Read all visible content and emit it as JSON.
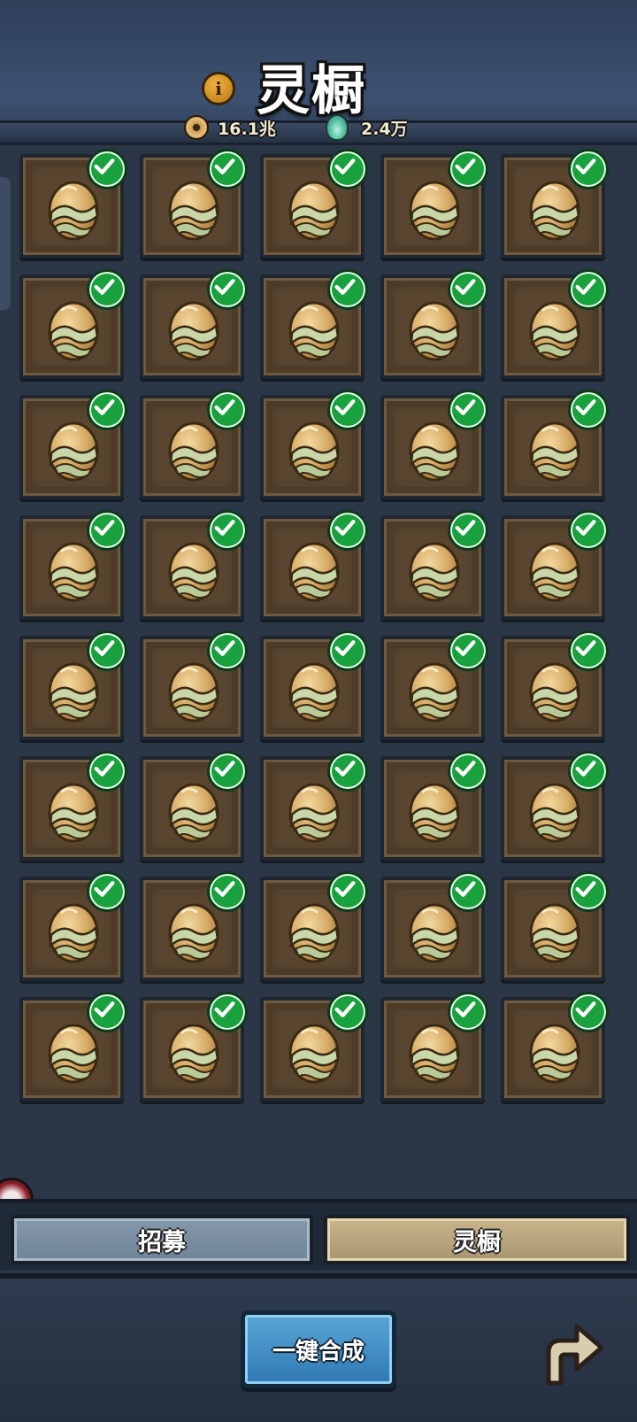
{
  "header": {
    "title": "灵橱",
    "currencies": [
      {
        "icon": "copper-coin-icon",
        "value": "16.1兆"
      },
      {
        "icon": "spirit-flame-icon",
        "value": "2.4万"
      }
    ]
  },
  "grid": {
    "rows": 8,
    "columns": 5,
    "item_icon": "spirit-egg-icon",
    "all_selected": true
  },
  "tabs": {
    "recruit_label": "招募",
    "cabinet_label": "灵橱",
    "active": "灵橱"
  },
  "footer": {
    "compose_label": "一键合成",
    "back_icon": "return-arrow-icon"
  },
  "colors": {
    "check_green": "#19a13e",
    "slot_brown": "#5a4630",
    "compose_blue": "#2f78b4"
  }
}
